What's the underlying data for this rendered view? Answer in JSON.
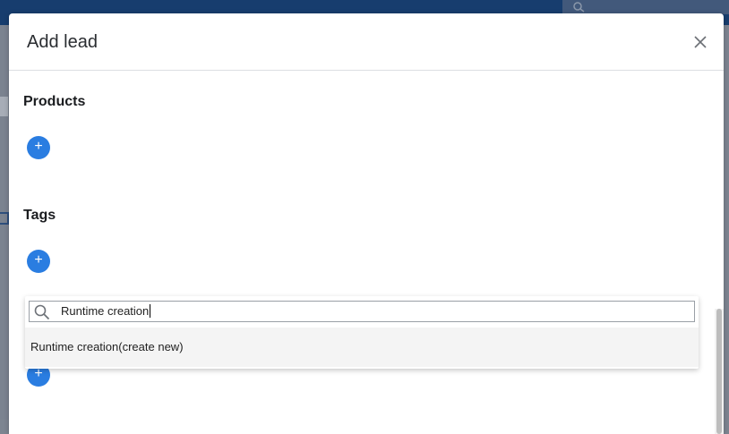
{
  "modal": {
    "title": "Add lead",
    "close_icon": "close-icon"
  },
  "sections": {
    "products": {
      "title": "Products",
      "add_label": "+"
    },
    "tags": {
      "title": "Tags",
      "add_label": "+"
    },
    "third": {
      "add_label": "+"
    }
  },
  "tag_dropdown": {
    "search_value": "Runtime creation",
    "search_icon": "search-icon",
    "options": [
      {
        "label": "Runtime creation(create new)"
      }
    ]
  },
  "colors": {
    "accent": "#2a7de1",
    "topbar": "#173d6e"
  }
}
